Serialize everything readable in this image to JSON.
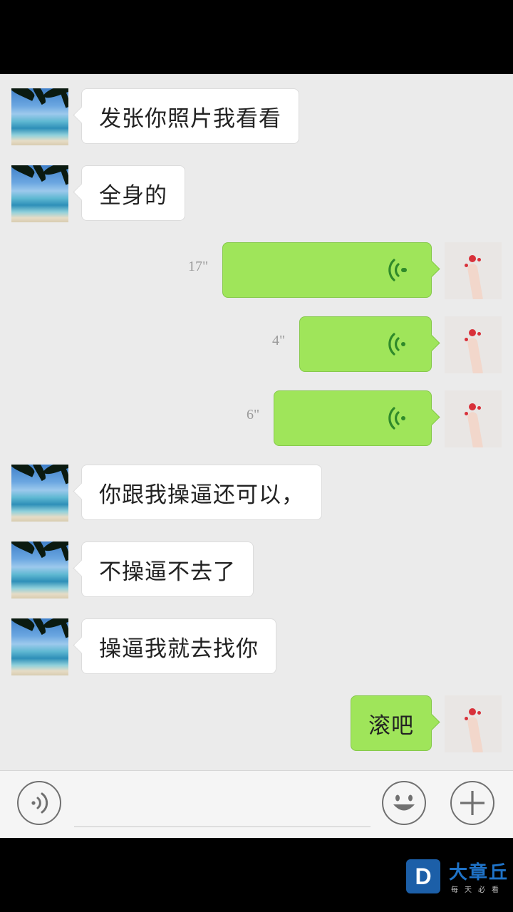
{
  "messages": [
    {
      "side": "in",
      "type": "text",
      "text": "发张你照片我看看"
    },
    {
      "side": "in",
      "type": "text",
      "text": "全身的"
    },
    {
      "side": "out",
      "type": "voice",
      "duration": "17\""
    },
    {
      "side": "out",
      "type": "voice",
      "duration": "4\""
    },
    {
      "side": "out",
      "type": "voice",
      "duration": "6\""
    },
    {
      "side": "in",
      "type": "text",
      "text": "你跟我操逼还可以，"
    },
    {
      "side": "in",
      "type": "text",
      "text": "不操逼不去了"
    },
    {
      "side": "in",
      "type": "text",
      "text": "操逼我就去找你"
    },
    {
      "side": "out",
      "type": "text",
      "text": "滚吧"
    }
  ],
  "input_bar": {
    "voice_button_icon": "voice-input-icon",
    "emoji_button_icon": "smiley-icon",
    "plus_button_icon": "plus-icon"
  },
  "watermark": {
    "badge": "D",
    "title": "大章丘",
    "subtitle": "每天必看"
  },
  "colors": {
    "outgoing_bubble": "#9fe55a",
    "incoming_bubble": "#ffffff",
    "chat_background": "#ebebeb"
  }
}
